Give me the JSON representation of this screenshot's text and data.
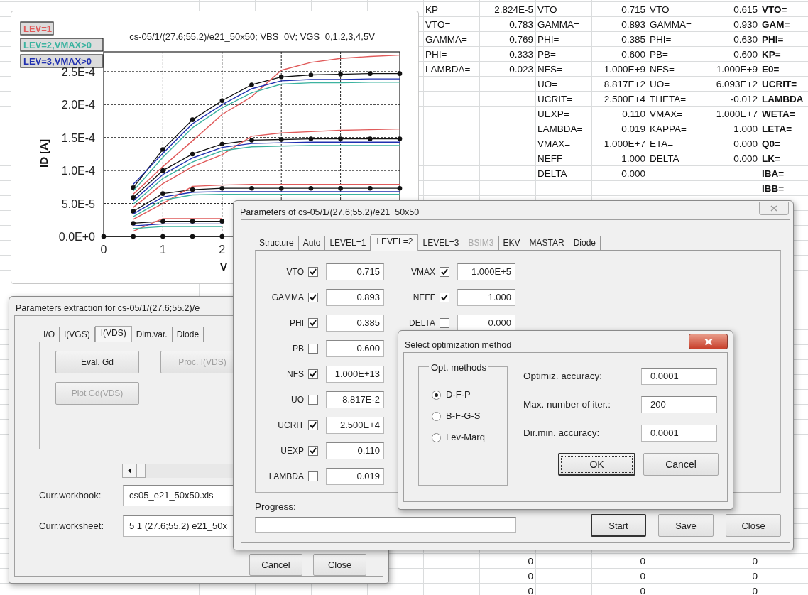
{
  "sheet": {
    "param_blocks": [
      {
        "entries": [
          {
            "label": "KP=",
            "value": "2.824E-5"
          },
          {
            "label": "VTO=",
            "value": "0.783"
          },
          {
            "label": "GAMMA=",
            "value": "0.769"
          },
          {
            "label": "PHI=",
            "value": "0.333"
          },
          {
            "label": "LAMBDA=",
            "value": "0.023"
          }
        ]
      },
      {
        "entries": [
          {
            "label": "VTO=",
            "value": "0.715"
          },
          {
            "label": "GAMMA=",
            "value": "0.893"
          },
          {
            "label": "PHI=",
            "value": "0.385"
          },
          {
            "label": "PB=",
            "value": "0.600"
          },
          {
            "label": "NFS=",
            "value": "1.000E+9"
          },
          {
            "label": "UO=",
            "value": "8.817E+2"
          },
          {
            "label": "UCRIT=",
            "value": "2.500E+4"
          },
          {
            "label": "UEXP=",
            "value": "0.110"
          },
          {
            "label": "LAMBDA=",
            "value": "0.019"
          },
          {
            "label": "VMAX=",
            "value": "1.000E+7"
          },
          {
            "label": "NEFF=",
            "value": "1.000"
          },
          {
            "label": "DELTA=",
            "value": "0.000"
          }
        ]
      },
      {
        "entries": [
          {
            "label": "VTO=",
            "value": "0.615"
          },
          {
            "label": "GAMMA=",
            "value": "0.930"
          },
          {
            "label": "PHI=",
            "value": "0.630"
          },
          {
            "label": "PB=",
            "value": "0.600"
          },
          {
            "label": "NFS=",
            "value": "1.000E+9"
          },
          {
            "label": "UO=",
            "value": "6.093E+2"
          },
          {
            "label": "THETA=",
            "value": "-0.012"
          },
          {
            "label": "VMAX=",
            "value": "1.000E+7"
          },
          {
            "label": "KAPPA=",
            "value": "1.000"
          },
          {
            "label": "ETA=",
            "value": "0.000"
          },
          {
            "label": "DELTA=",
            "value": "0.000"
          }
        ]
      }
    ],
    "name_column": [
      "VTO=",
      "GAM=",
      "PHI=",
      "KP=",
      "E0=",
      "UCRIT=",
      "LAMBDA",
      "WETA=",
      "LETA=",
      "Q0=",
      "LK=",
      "IBA=",
      "IBB="
    ],
    "bottom_rows": [
      [
        "0",
        "0",
        "0"
      ],
      [
        "0",
        "0",
        "0"
      ],
      [
        "0",
        "0",
        "0"
      ]
    ]
  },
  "chart": {
    "chart_data": {
      "type": "line",
      "title": "cs-05/1/(27.6;55.2)/e21_50x50;  VBS=0V;  VGS=0,1,2,3,4,5V",
      "xlabel": "V",
      "ylabel": "ID [A]",
      "grid": true,
      "x": [
        0,
        0.5,
        1,
        1.5,
        2,
        2.5,
        3,
        3.5,
        4,
        4.5,
        5
      ],
      "xlim": [
        0,
        5
      ],
      "ylim": [
        0,
        0.00028
      ],
      "xticks": [
        0,
        1,
        2
      ],
      "yticks": [
        {
          "value": 0,
          "label": "0.0E+0"
        },
        {
          "value": 5e-05,
          "label": "5.0E-5"
        },
        {
          "value": 0.0001,
          "label": "1.0E-4"
        },
        {
          "value": 0.00015,
          "label": "1.5E-4"
        },
        {
          "value": 0.0002,
          "label": "2.0E-4"
        },
        {
          "value": 0.00025,
          "label": "2.5E-4"
        }
      ],
      "series": [
        {
          "color": "#111111",
          "marker": "circle",
          "values": [
            null,
            7.4e-05,
            0.000132,
            0.000177,
            0.000206,
            0.00023,
            0.000242,
            0.000245,
            0.000246,
            0.000247,
            0.000247
          ]
        },
        {
          "color": "#111111",
          "marker": "circle",
          "values": [
            null,
            5.9e-05,
            0.0001,
            0.000125,
            0.00014,
            0.000146,
            0.000147,
            0.000148,
            0.000148,
            0.000148,
            0.000148
          ]
        },
        {
          "color": "#111111",
          "marker": "circle",
          "values": [
            null,
            3.8e-05,
            6.5e-05,
            7.1e-05,
            7.3e-05,
            7.3e-05,
            7.3e-05,
            7.3e-05,
            7.3e-05,
            7.3e-05,
            7.3e-05
          ]
        },
        {
          "color": "#111111",
          "marker": "circle",
          "values": [
            null,
            2e-05,
            2.3e-05,
            2.3e-05,
            2.3e-05,
            null,
            null,
            null,
            null,
            null,
            null
          ]
        },
        {
          "color": "#111111",
          "marker": "circle",
          "values": [
            0,
            0,
            0,
            0,
            0,
            null,
            null,
            null,
            null,
            null,
            null
          ]
        },
        {
          "name": "LEV=1",
          "color": "#e05a5a",
          "values": [
            null,
            6.4e-05,
            0.000106,
            0.000145,
            0.000185,
            0.000212,
            0.000252,
            0.000264,
            0.00027,
            0.000273,
            0.000275
          ]
        },
        {
          "color": "#e05a5a",
          "values": [
            null,
            4.4e-05,
            8e-05,
            0.000106,
            0.000124,
            0.000152,
            0.000157,
            0.000159,
            0.000161,
            0.000162,
            0.000163
          ]
        },
        {
          "color": "#e05a5a",
          "values": [
            null,
            2.6e-05,
            5e-05,
            7.6e-05,
            7.8e-05,
            7.9e-05,
            7.9e-05,
            7.9e-05,
            7.9e-05,
            7.9e-05,
            7.9e-05
          ]
        },
        {
          "color": "#e05a5a",
          "values": [
            null,
            8e-06,
            2.7e-05,
            2.7e-05,
            2.7e-05,
            null,
            null,
            null,
            null,
            null,
            null
          ]
        },
        {
          "name": "LEV=2,VMAX>0",
          "color": "#3cb3a0",
          "values": [
            null,
            6.9e-05,
            0.00012,
            0.000165,
            0.000195,
            0.000218,
            0.000231,
            0.000233,
            0.000233,
            0.000234,
            0.000234
          ]
        },
        {
          "color": "#3cb3a0",
          "values": [
            null,
            4.9e-05,
            8.8e-05,
            0.000113,
            0.00013,
            0.000136,
            0.000137,
            0.000138,
            0.000138,
            0.000138,
            0.000138
          ]
        },
        {
          "color": "#3cb3a0",
          "values": [
            null,
            3e-05,
            5.5e-05,
            6.3e-05,
            6.4e-05,
            6.4e-05,
            6.4e-05,
            6.4e-05,
            6.4e-05,
            6.4e-05,
            6.4e-05
          ]
        },
        {
          "color": "#3cb3a0",
          "values": [
            null,
            1.2e-05,
            1.5e-05,
            1.5e-05,
            1.5e-05,
            null,
            null,
            null,
            null,
            null,
            null
          ]
        },
        {
          "name": "LEV=3,VMAX>0",
          "color": "#2030b0",
          "values": [
            null,
            7.9e-05,
            0.000126,
            0.000171,
            0.0002,
            0.000224,
            0.000236,
            0.000238,
            0.000238,
            0.000239,
            0.000239
          ]
        },
        {
          "color": "#2030b0",
          "values": [
            null,
            5.4e-05,
            9.4e-05,
            0.000119,
            0.000135,
            0.000141,
            0.000142,
            0.000143,
            0.000143,
            0.000143,
            0.000143
          ]
        },
        {
          "color": "#2030b0",
          "values": [
            null,
            3.4e-05,
            6e-05,
            6.7e-05,
            6.8e-05,
            6.8e-05,
            6.8e-05,
            6.8e-05,
            6.8e-05,
            6.8e-05,
            6.8e-05
          ]
        },
        {
          "color": "#2030b0",
          "values": [
            null,
            1.6e-05,
            1.9e-05,
            1.9e-05,
            1.9e-05,
            null,
            null,
            null,
            null,
            null,
            null
          ]
        }
      ]
    }
  },
  "extraction_dialog": {
    "title": "Parameters extraction for cs-05/1/(27.6;55.2)/e",
    "tabs": [
      {
        "label": "I/O",
        "selected": false
      },
      {
        "label": "I(VGS)",
        "selected": false
      },
      {
        "label": "I(VDS)",
        "selected": true
      },
      {
        "label": "Dim.var.",
        "selected": false
      },
      {
        "label": "Diode",
        "selected": false
      }
    ],
    "buttons": [
      {
        "label": "Eval. Gd",
        "disabled": false
      },
      {
        "label": "Proc. I(VDS)",
        "disabled": true
      },
      {
        "label": "Plot Gd(VDS)",
        "disabled": true
      }
    ],
    "fields": [
      {
        "label": "Curr.workbook:",
        "value": "cs05_e21_50x50.xls"
      },
      {
        "label": "Curr.worksheet:",
        "value": "5 1 (27.6;55.2) e21_50x"
      }
    ],
    "footer_buttons": [
      "Cancel",
      "Close"
    ]
  },
  "parameters_dialog": {
    "title": "Parameters of cs-05/1/(27.6;55.2)/e21_50x50",
    "tabs": [
      {
        "label": "Structure",
        "selected": false,
        "disabled": false
      },
      {
        "label": "Auto",
        "selected": false,
        "disabled": false
      },
      {
        "label": "LEVEL=1",
        "selected": false,
        "disabled": false
      },
      {
        "label": "LEVEL=2",
        "selected": true,
        "disabled": false
      },
      {
        "label": "LEVEL=3",
        "selected": false,
        "disabled": false
      },
      {
        "label": "BSIM3",
        "selected": false,
        "disabled": true
      },
      {
        "label": "EKV",
        "selected": false,
        "disabled": false
      },
      {
        "label": "MASTAR",
        "selected": false,
        "disabled": false
      },
      {
        "label": "Diode",
        "selected": false,
        "disabled": false
      }
    ],
    "param_columns": [
      [
        {
          "name": "VTO",
          "checked": true,
          "value": "0.715"
        },
        {
          "name": "GAMMA",
          "checked": true,
          "value": "0.893"
        },
        {
          "name": "PHI",
          "checked": true,
          "value": "0.385"
        },
        {
          "name": "PB",
          "checked": false,
          "value": "0.600"
        },
        {
          "name": "NFS",
          "checked": true,
          "value": "1.000E+13"
        },
        {
          "name": "UO",
          "checked": false,
          "value": "8.817E-2"
        },
        {
          "name": "UCRIT",
          "checked": true,
          "value": "2.500E+4"
        },
        {
          "name": "UEXP",
          "checked": true,
          "value": "0.110"
        },
        {
          "name": "LAMBDA",
          "checked": false,
          "value": "0.019"
        }
      ],
      [
        {
          "name": "VMAX",
          "checked": true,
          "value": "1.000E+5"
        },
        {
          "name": "NEFF",
          "checked": true,
          "value": "1.000"
        },
        {
          "name": "DELTA",
          "checked": false,
          "value": "0.000"
        }
      ]
    ],
    "progress_label": "Progress:",
    "progress": {
      "level": 0
    },
    "buttons": [
      {
        "label": "Start",
        "default": true
      },
      {
        "label": "Save",
        "default": false
      },
      {
        "label": "Close",
        "default": false
      }
    ]
  },
  "optimization_dialog": {
    "title": "Select optimization method",
    "group_label": "Opt. methods",
    "methods": [
      {
        "label": "D-F-P",
        "selected": true
      },
      {
        "label": "B-F-G-S",
        "selected": false
      },
      {
        "label": "Lev-Marq",
        "selected": false
      }
    ],
    "settings": [
      {
        "label": "Optimiz. accuracy:",
        "value": "0.0001"
      },
      {
        "label": "Max. number of iter.:",
        "value": "200"
      },
      {
        "label": "Dir.min. accuracy:",
        "value": "0.0001"
      }
    ],
    "buttons": [
      {
        "label": "OK",
        "focused": true
      },
      {
        "label": "Cancel",
        "focused": false
      }
    ]
  }
}
